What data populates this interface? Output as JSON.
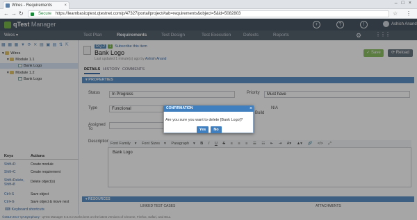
{
  "browser": {
    "tab_title": "Wires - Requirements",
    "secure_label": "Secure",
    "url": "https://learnbasicqtest.qtestnet.com/p/47327/portal/project#tab=requirements&object=5&id=5082803"
  },
  "app": {
    "logo_q": "qTest",
    "logo_m": "Manager",
    "user_name": "Ashish Anand",
    "project": "Wires ▾"
  },
  "nav": {
    "items": [
      "Test Plan",
      "Requirements",
      "Test Design",
      "Test Execution",
      "Defects",
      "Reports"
    ],
    "active": "Requirements"
  },
  "tree": {
    "root": "Wires",
    "items": [
      {
        "label": "Module 1.1",
        "kind": "module"
      },
      {
        "label": "Bank Logo",
        "kind": "requirement",
        "selected": true
      },
      {
        "label": "Module 1.2",
        "kind": "module"
      },
      {
        "label": "Bank Logo",
        "kind": "requirement"
      }
    ]
  },
  "shortcuts": {
    "header_keys": "Keys",
    "header_actions": "Actions",
    "rows": [
      {
        "key": "Shift+D",
        "action": "Create module"
      },
      {
        "key": "Shift+C",
        "action": "Create requirement"
      },
      {
        "key": "Shift+Delete, Shift+8",
        "action": "Delete object(s)"
      },
      {
        "key": "Ctrl+S",
        "action": "Save object"
      },
      {
        "key": "Ctrl+G",
        "action": "Save object & move next"
      }
    ],
    "link": "Keyboard shortcuts"
  },
  "requirement": {
    "id": "RQ-2",
    "count": "1",
    "subscribe": "Subscribe this item",
    "title": "Bank Logo",
    "updated_prefix": "Last updated 1 minute(s) ago by",
    "updated_by": "Ashish Anand",
    "save_label": "Save",
    "reload_label": "Reload",
    "subtabs": [
      "DETAILS",
      "HISTORY",
      "COMMENTS"
    ]
  },
  "properties": {
    "bar": "PROPERTIES",
    "status_label": "Status",
    "status_value": "In Progress",
    "priority_label": "Priority",
    "priority_value": "Must have",
    "type_label": "Type",
    "type_value": "Functional",
    "build_label": "Build",
    "build_value": "N/A",
    "assigned_label": "Assigned To",
    "description_label": "Description",
    "description_value": "Bank Logo",
    "editor_tools": [
      "Font Family",
      "Font Sizes",
      "Paragraph",
      "B",
      "I",
      "U",
      "S"
    ]
  },
  "resources": {
    "bar": "RESOURCES",
    "col1": "LINKED TEST CASES",
    "col2": "ATTACHMENTS"
  },
  "footer": {
    "copy": "©2010-2017 QASymphony",
    "text": " - qTest Manager 8.5.0.0 works best on the latest versions of Chrome, Firefox, Safari, and IE11."
  },
  "dialog": {
    "title": "CONFIRMATION",
    "message": "Are you sure you want to delete [Bank Logo]?",
    "yes": "Yes",
    "no": "No"
  },
  "colors": {
    "header": "#4a5866",
    "accent": "#3f7fc0",
    "save": "#8cc063",
    "section_bar": "#5f94c8"
  }
}
